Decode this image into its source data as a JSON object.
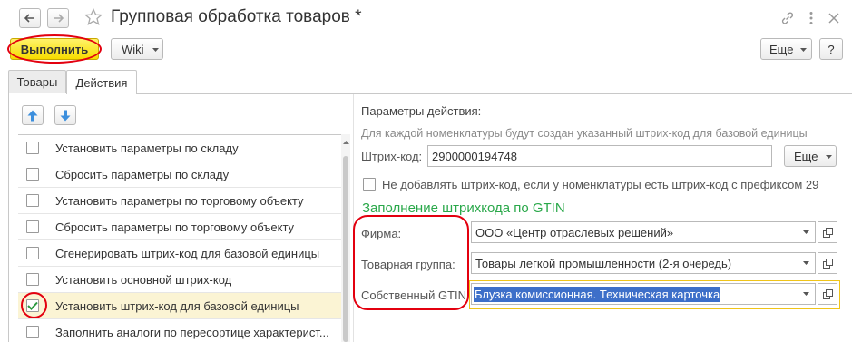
{
  "window": {
    "title": "Групповая обработка товаров *"
  },
  "toolbar": {
    "execute_label": "Выполнить",
    "wiki_label": "Wiki",
    "more_label": "Еще",
    "help_label": "?"
  },
  "tabs": [
    {
      "label": "Товары",
      "active": false
    },
    {
      "label": "Действия",
      "active": true
    }
  ],
  "actions_list": [
    {
      "label": "Установить параметры по складу",
      "checked": false
    },
    {
      "label": "Сбросить параметры по складу",
      "checked": false
    },
    {
      "label": "Установить параметры по торговому объекту",
      "checked": false
    },
    {
      "label": "Сбросить параметры по торговому объекту",
      "checked": false
    },
    {
      "label": "Сгенерировать штрих-код для базовой единицы",
      "checked": false
    },
    {
      "label": "Установить основной штрих-код",
      "checked": false
    },
    {
      "label": "Установить штрих-код для базовой единицы",
      "checked": true
    },
    {
      "label": "Заполнить аналоги по пересортице характерист...",
      "checked": false
    }
  ],
  "params": {
    "header": "Параметры действия:",
    "hint": "Для каждой номенклатуры будут создан указанный штрих-код для базовой единицы",
    "barcode_label": "Штрих-код:",
    "barcode_value": "2900000194748",
    "barcode_more_label": "Еще",
    "skip_checkbox_label": "Не добавлять штрих-код, если у номенклатуры есть штрих-код с префиксом 29",
    "skip_checked": false,
    "section_title": "Заполнение штрихкода по GTIN",
    "firm_label": "Фирма:",
    "firm_value": "ООО «Центр отраслевых решений»",
    "group_label": "Товарная группа:",
    "group_value": "Товары легкой промышленности (2-я очередь)",
    "gtin_label": "Собственный GTIN:",
    "gtin_value": "Блузка комиссионная. Техническая карточка"
  },
  "colors": {
    "accent_yellow": "#f7dc00",
    "highlight_red": "#e3000f",
    "section_green": "#2aa84a",
    "arrow_blue": "#3c8fdd",
    "selection_blue": "#3d6fc9"
  }
}
